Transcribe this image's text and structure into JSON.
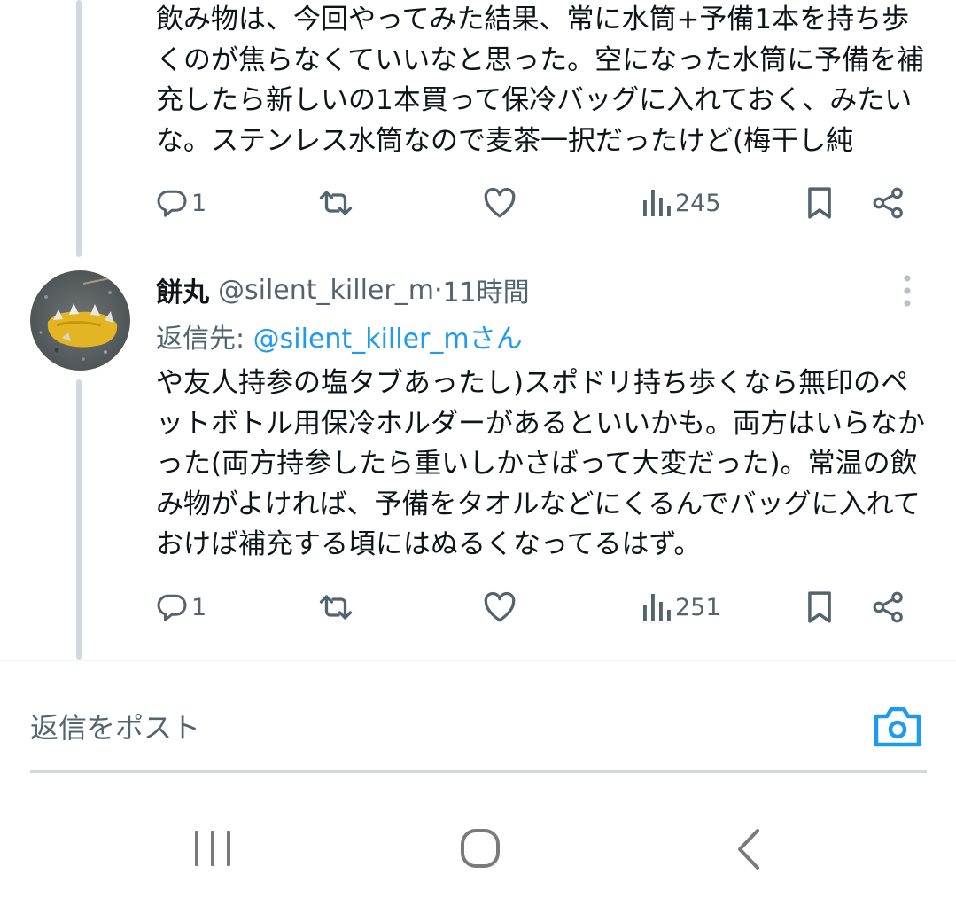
{
  "tweet_1": {
    "text": "飲み物は、今回やってみた結果、常に水筒+予備1本を持ち歩\nくのが焦らなくていいなと思った。空になった水筒に予備を補\n充したら新しいの1本買って保冷バッグに入れておく、みたい\nな。ステンレス水筒なので麦茶一択だったけど(梅干し純",
    "replies": "1",
    "retweets": "",
    "likes": "",
    "views": "245"
  },
  "tweet_2": {
    "author_name": "餅丸",
    "handle": "@silent_killer_m",
    "separator": " · ",
    "time": "11時間",
    "reply_to_label": "返信先: ",
    "reply_to_mention": "@silent_killer_mさん",
    "text": "や友人持参の塩タブあったし)スポドリ持ち歩くなら無印のペ\nットボトル用保冷ホルダーがあるといいかも。両方はいらなか\nった(両方持参したら重いしかさばって大変だった)。常温の飲\nみ物がよければ、予備をタオルなどにくるんでバッグに入れて\nおけば補充する頃にはぬるくなってるはず。",
    "replies": "1",
    "retweets": "",
    "likes": "",
    "views": "251"
  },
  "compose": {
    "placeholder": "返信をポスト"
  },
  "colors": {
    "text": "#0f1419",
    "muted": "#536471",
    "accent": "#1d9bf0",
    "thread_line": "#cfd9de"
  },
  "icons": [
    "reply-icon",
    "retweet-icon",
    "like-icon",
    "views-icon",
    "bookmark-icon",
    "share-icon",
    "more-icon",
    "camera-icon",
    "recents-icon",
    "home-icon",
    "back-icon"
  ]
}
